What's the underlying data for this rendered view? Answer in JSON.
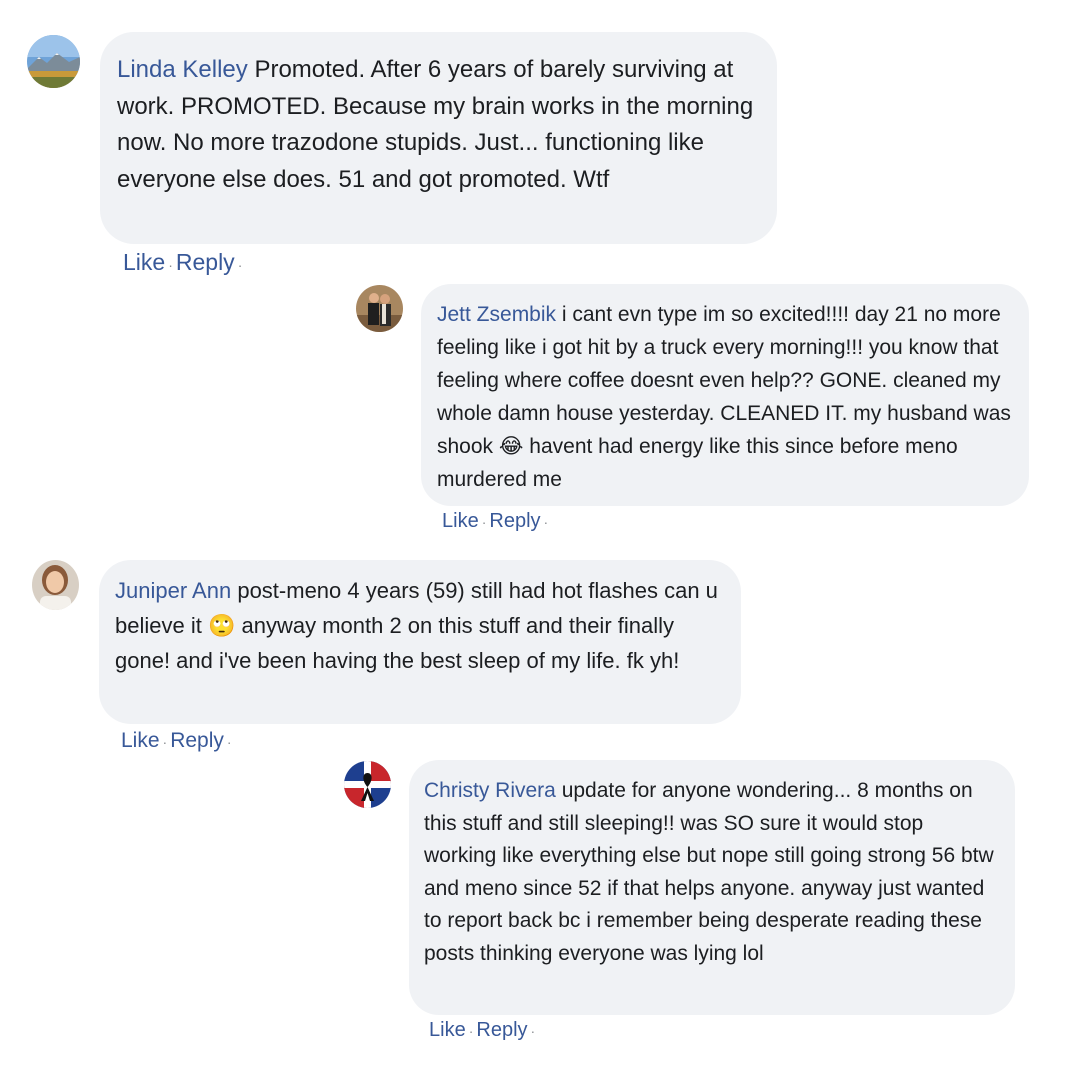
{
  "comments": [
    {
      "author": "Linda Kelley",
      "text": "Promoted. After 6 years of barely surviving at work. PROMOTED. Because my brain works in the morning now. No more trazodone stupids. Just... functioning like everyone else does. 51 and got promoted. Wtf",
      "like": "Like",
      "reply": "Reply",
      "avatar_icon": "mountain-landscape-avatar"
    },
    {
      "author": "Jett Zsembik",
      "text_before_emoji": "i cant evn type im so excited!!!! day 21 no more feeling like i got hit by a truck every morning!!! you know that feeling where coffee doesnt even help?? GONE. cleaned my whole damn house yesterday. CLEANED IT. my husband was shook",
      "emoji": "😂",
      "text_after_emoji": "havent had energy like this since before meno murdered me",
      "like": "Like",
      "reply": "Reply",
      "avatar_icon": "couple-photo-avatar"
    },
    {
      "author": "Juniper Ann",
      "text_before_emoji": "post-meno 4 years (59) still had hot flashes can u believe it",
      "emoji": "🙄",
      "text_after_emoji": "anyway month 2 on this stuff and their finally gone! and i've been having the best sleep of my life. fk yh!",
      "like": "Like",
      "reply": "Reply",
      "avatar_icon": "woman-portrait-avatar"
    },
    {
      "author": "Christy Rivera",
      "text": "update for anyone wondering... 8 months on this stuff and still sleeping!! was SO sure it would stop working like everything else but nope still going strong 56 btw and meno since 52 if that helps anyone. anyway just wanted to report back bc i remember being desperate reading these posts thinking everyone was lying lol",
      "like": "Like",
      "reply": "Reply",
      "avatar_icon": "flag-ribbon-avatar"
    }
  ],
  "colors": {
    "link": "#385898",
    "bubble": "#f0f2f5",
    "text": "#1c1e21",
    "dot": "#8a8d91"
  }
}
